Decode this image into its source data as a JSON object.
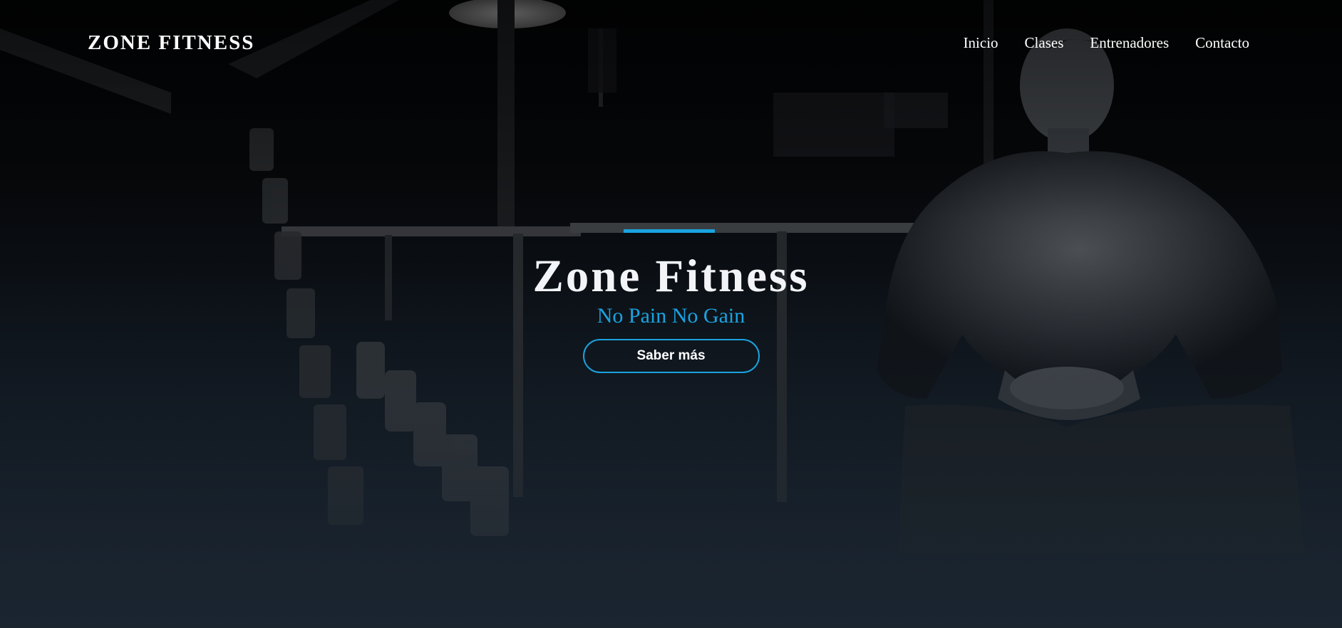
{
  "nav": {
    "logo": "ZONE FITNESS",
    "links": [
      "Inicio",
      "Clases",
      "Entrenadores",
      "Contacto"
    ]
  },
  "hero": {
    "title": "Zone Fitness",
    "subtitle": "No Pain No Gain",
    "cta_label": "Saber más",
    "background": "dark gym photo with dumbbell rack and seated muscular man"
  },
  "colors": {
    "accent": "#1aa3e0",
    "text": "#ffffff",
    "bg_dark": "#030405",
    "bg_bottom": "#1a2430"
  }
}
